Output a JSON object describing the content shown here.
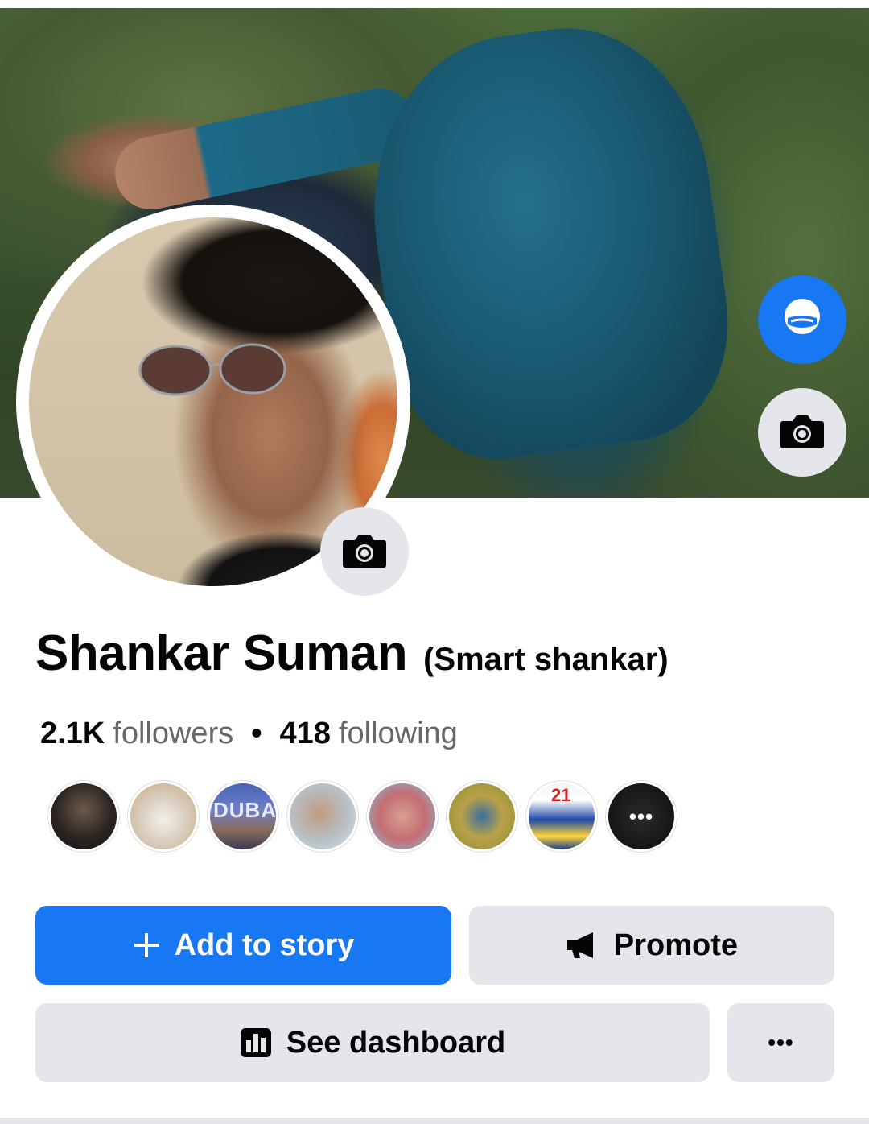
{
  "profile": {
    "name": "Shankar Suman",
    "alternate_name": "(Smart shankar)",
    "followers_count": "2.1K",
    "followers_label": "followers",
    "following_count": "418",
    "following_label": "following",
    "separator": "•"
  },
  "friends_preview": {
    "avatars": [
      {
        "name": "friend-avatar-1"
      },
      {
        "name": "friend-avatar-2"
      },
      {
        "name": "friend-avatar-3",
        "text": "DUBAI"
      },
      {
        "name": "friend-avatar-4"
      },
      {
        "name": "friend-avatar-5"
      },
      {
        "name": "friend-avatar-6"
      },
      {
        "name": "friend-avatar-7",
        "text": "21"
      }
    ],
    "more_label": "•••"
  },
  "actions": {
    "add_to_story": "Add to story",
    "promote": "Promote",
    "see_dashboard": "See dashboard",
    "more": "•••"
  },
  "icons": {
    "avatar_button": "avatar-icon",
    "cover_camera": "camera-icon",
    "profile_camera": "camera-icon",
    "add_story": "plus-icon",
    "promote": "megaphone-icon",
    "dashboard": "bar-chart-icon",
    "more": "more-icon"
  },
  "colors": {
    "primary": "#1877f2",
    "secondary_button": "#e4e6eb",
    "text_primary": "#050505",
    "text_secondary": "#65676b"
  }
}
